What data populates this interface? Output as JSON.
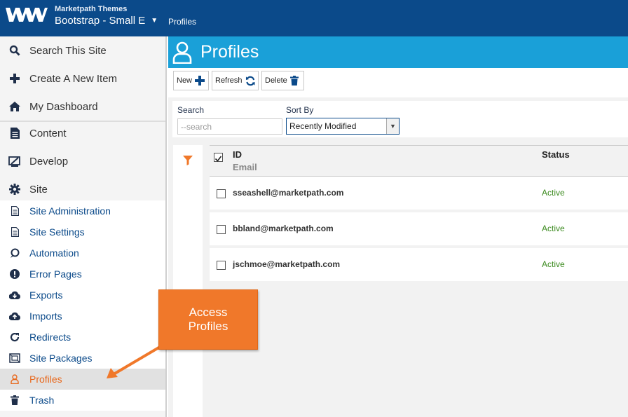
{
  "header": {
    "org": "Marketpath Themes",
    "site": "Bootstrap - Small E",
    "breadcrumb": "Profiles"
  },
  "sidebar": {
    "top_items": [
      {
        "label": "Search This Site",
        "icon": "search-icon"
      },
      {
        "label": "Create A New Item",
        "icon": "plus-icon"
      },
      {
        "label": "My Dashboard",
        "icon": "home-icon"
      }
    ],
    "sections": [
      {
        "label": "Content",
        "icon": "document-icon"
      },
      {
        "label": "Develop",
        "icon": "develop-icon"
      },
      {
        "label": "Site",
        "icon": "gear-icon"
      }
    ],
    "site_items": [
      {
        "label": "Site Administration",
        "icon": "document-icon"
      },
      {
        "label": "Site Settings",
        "icon": "document-icon"
      },
      {
        "label": "Automation",
        "icon": "automation-icon"
      },
      {
        "label": "Error Pages",
        "icon": "exclamation-icon"
      },
      {
        "label": "Exports",
        "icon": "cloud-download-icon"
      },
      {
        "label": "Imports",
        "icon": "cloud-upload-icon"
      },
      {
        "label": "Redirects",
        "icon": "redirect-icon"
      },
      {
        "label": "Site Packages",
        "icon": "package-icon"
      },
      {
        "label": "Profiles",
        "icon": "user-icon",
        "active": true
      },
      {
        "label": "Trash",
        "icon": "trash-icon"
      }
    ]
  },
  "page": {
    "title": "Profiles",
    "toolbar": {
      "new": "New",
      "refresh": "Refresh",
      "delete": "Delete"
    },
    "search": {
      "label": "Search",
      "placeholder": "--search"
    },
    "sort": {
      "label": "Sort By",
      "value": "Recently Modified"
    }
  },
  "list": {
    "headers": {
      "id": "ID",
      "email": "Email",
      "status": "Status"
    },
    "rows": [
      {
        "email": "sseashell@marketpath.com",
        "status": "Active"
      },
      {
        "email": "bbland@marketpath.com",
        "status": "Active"
      },
      {
        "email": "jschmoe@marketpath.com",
        "status": "Active"
      }
    ]
  },
  "callout": {
    "line1": "Access",
    "line2": "Profiles"
  },
  "colors": {
    "header": "#0b4a8a",
    "title_bar": "#1aa0d8",
    "accent": "#f0782a",
    "active_status": "#3b8a1e"
  }
}
